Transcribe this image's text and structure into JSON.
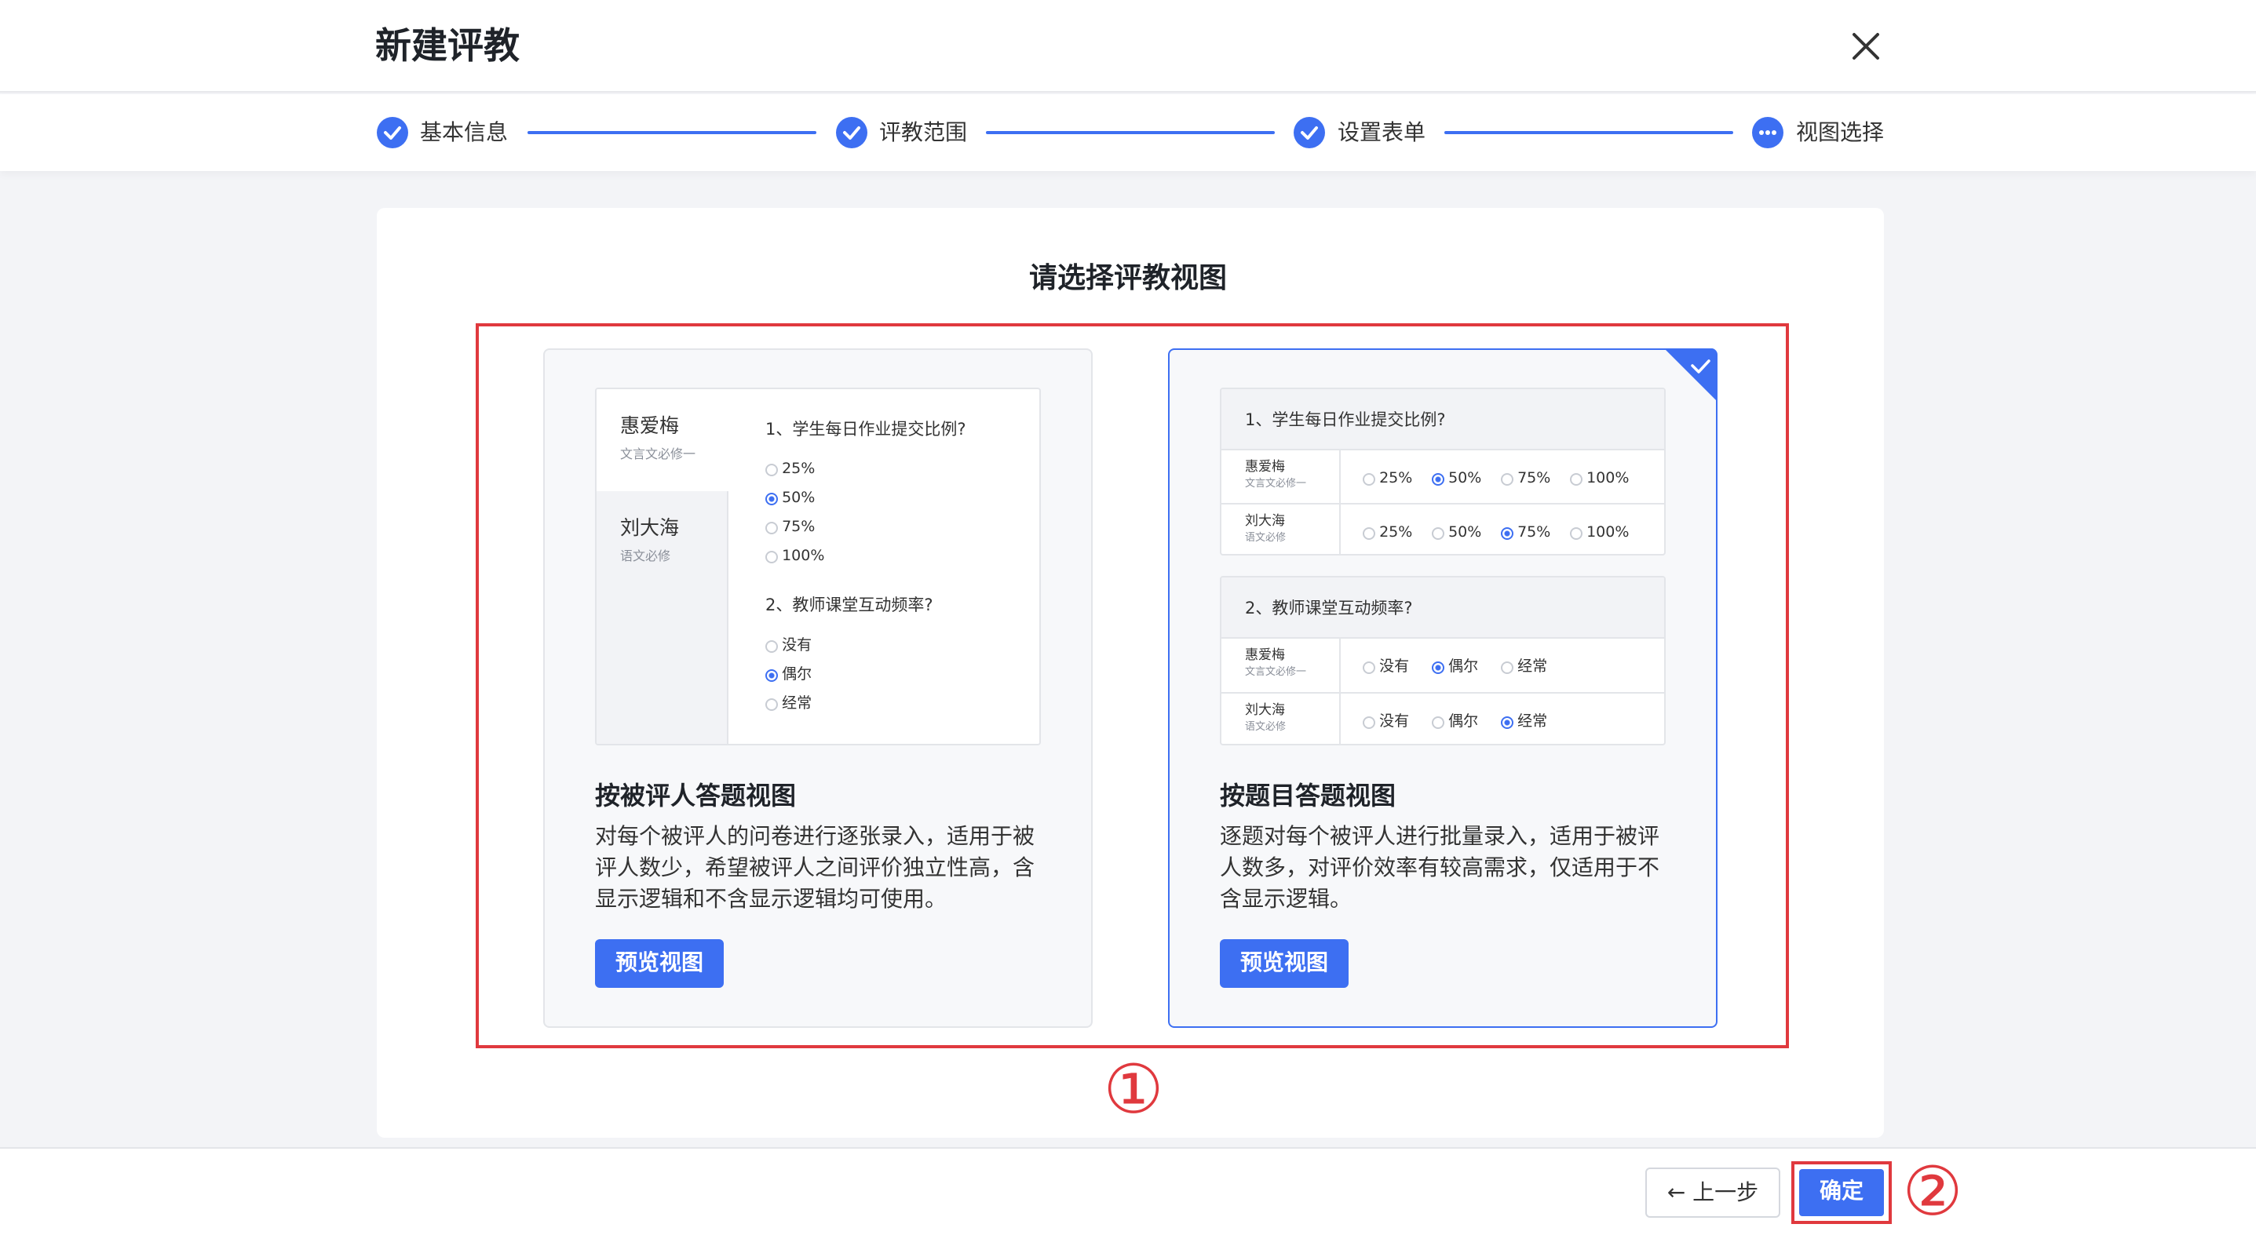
{
  "dialog": {
    "title": "新建评教"
  },
  "steps": [
    {
      "label": "基本信息",
      "state": "done"
    },
    {
      "label": "评教范围",
      "state": "done"
    },
    {
      "label": "设置表单",
      "state": "done"
    },
    {
      "label": "视图选择",
      "state": "current"
    }
  ],
  "main": {
    "heading": "请选择评教视图",
    "options": [
      {
        "title": "按被评人答题视图",
        "description": "对每个被评人的问卷进行逐张录入，适用于被\n评人数少，希望被评人之间评价独立性高，含\n显示逻辑和不含显示逻辑均可使用。",
        "button": "预览视图",
        "selected": false,
        "preview": {
          "people": [
            {
              "name": "惠爱梅",
              "course": "文言文必修一"
            },
            {
              "name": "刘大海",
              "course": "语文必修"
            }
          ],
          "q1": {
            "title": "1、学生每日作业提交比例?",
            "options": [
              "25%",
              "50%",
              "75%",
              "100%"
            ]
          },
          "q2": {
            "title": "2、教师课堂互动频率?",
            "options": [
              "没有",
              "偶尔",
              "经常"
            ]
          }
        }
      },
      {
        "title": "按题目答题视图",
        "description": "逐题对每个被评人进行批量录入，适用于被评\n人数多，对评价效率有较高需求，仅适用于不\n含显示逻辑。",
        "button": "预览视图",
        "selected": true,
        "preview": {
          "q1": {
            "title": "1、学生每日作业提交比例?",
            "options": [
              "25%",
              "50%",
              "75%",
              "100%"
            ]
          },
          "q2": {
            "title": "2、教师课堂互动频率?",
            "options": [
              "没有",
              "偶尔",
              "经常"
            ]
          },
          "people": [
            {
              "name": "惠爱梅",
              "course": "文言文必修一"
            },
            {
              "name": "刘大海",
              "course": "语文必修"
            }
          ]
        }
      }
    ],
    "annotation_1": "①",
    "annotation_2": "②"
  },
  "footer": {
    "back_label": "上一步",
    "confirm_label": "确定"
  },
  "colors": {
    "accent": "#3d6ff2",
    "annotation": "#e0393e"
  }
}
